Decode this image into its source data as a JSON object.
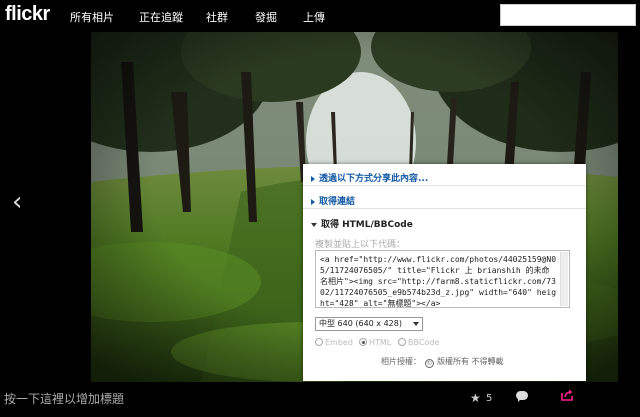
{
  "brand": {
    "logo": "flickr"
  },
  "nav": {
    "items": [
      {
        "id": "all-photos",
        "label": "所有相片"
      },
      {
        "id": "following",
        "label": "正在追蹤"
      },
      {
        "id": "groups",
        "label": "社群"
      },
      {
        "id": "explore",
        "label": "發掘"
      },
      {
        "id": "upload",
        "label": "上傳"
      }
    ],
    "search_placeholder": ""
  },
  "viewer": {
    "prev_glyph": "‹"
  },
  "share_panel": {
    "share_via": "透過以下方式分享此內容...",
    "get_link": "取得連結",
    "get_html": "取得 HTML/BBCode",
    "copy_hint": "複製並貼上以下代碼：",
    "code": "<a href=\"http://www.flickr.com/photos/44025159@N05/11724076505/\" title=\"Flickr 上 brianshih 的未命名相片\"><img src=\"http://farm8.staticflickr.com/7302/11724076505_e9b574b23d_z.jpg\" width=\"640\" height=\"428\" alt=\"無標題\"></a>",
    "size_selected": "中型 640 (640 x 428)",
    "formats": [
      {
        "label": "Embed",
        "selected": false
      },
      {
        "label": "HTML",
        "selected": true
      },
      {
        "label": "BBCode",
        "selected": false
      }
    ],
    "license_label": "相片授權：",
    "license_value": "版權所有 不得轉載"
  },
  "footer": {
    "title_hint": "按一下這裡以增加標題",
    "fav_count": "5"
  },
  "colors": {
    "link": "#1259a5",
    "share_icon": "#ff1e8c"
  }
}
